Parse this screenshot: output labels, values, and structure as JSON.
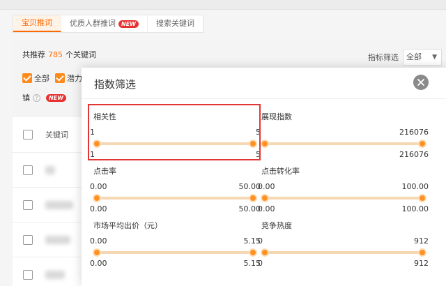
{
  "tabs": [
    {
      "label": "宝贝推词",
      "active": true
    },
    {
      "label": "优质人群推词",
      "badge": "NEW"
    },
    {
      "label": "搜索关键词"
    }
  ],
  "summary": {
    "prefix": "共推荐",
    "count": "785",
    "suffix": "个关键词"
  },
  "metric_filter": {
    "label": "指标筛选",
    "selected": "全部"
  },
  "filters": {
    "all": "全部",
    "potential": "潜力",
    "row2_text": "镇",
    "row2_badge": "NEW"
  },
  "table": {
    "header": "关键词",
    "rows": 4
  },
  "modal": {
    "title": "指数筛选",
    "sliders": [
      {
        "label": "相关性",
        "min": "1",
        "max": "5",
        "low": "1",
        "high": "5"
      },
      {
        "label": "展现指数",
        "min": "",
        "max": "216076",
        "low": "",
        "high": "216076"
      },
      {
        "label": "点击率",
        "min": "0.00",
        "max": "50.00",
        "low": "0.00",
        "high": "50.00"
      },
      {
        "label": "点击转化率",
        "min": "0.00",
        "max": "100.00",
        "low": "0.00",
        "high": "100.00"
      },
      {
        "label": "市场平均出价（元）",
        "min": "0.00",
        "max": "5.15",
        "low": "0.00",
        "high": "5.15"
      },
      {
        "label": "竞争热度",
        "min": "0",
        "max": "912",
        "low": "0",
        "high": "912"
      }
    ]
  },
  "colors": {
    "accent": "#ff6a00",
    "knob": "#ff9224",
    "track": "#f5d7b3",
    "highlight": "#e23636"
  }
}
